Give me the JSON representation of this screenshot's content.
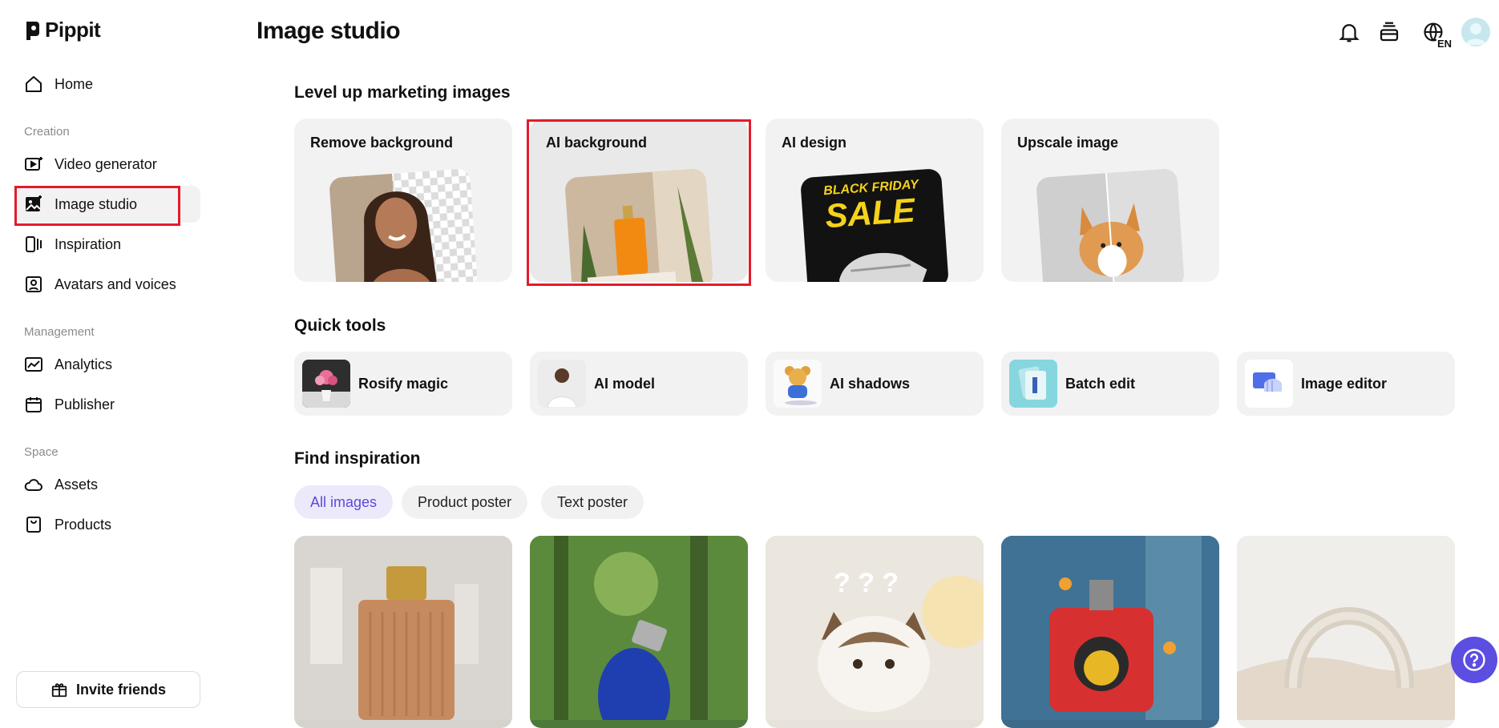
{
  "app": {
    "brand": "Pippit"
  },
  "header": {
    "title": "Image studio",
    "language": "EN"
  },
  "sidebar": {
    "home": "Home",
    "sections": {
      "creation": "Creation",
      "management": "Management",
      "space": "Space"
    },
    "items": {
      "video_generator": "Video generator",
      "image_studio": "Image studio",
      "inspiration": "Inspiration",
      "avatars_voices": "Avatars and voices",
      "analytics": "Analytics",
      "publisher": "Publisher",
      "assets": "Assets",
      "products": "Products"
    },
    "invite": "Invite friends"
  },
  "level_up": {
    "title": "Level up marketing images",
    "cards": [
      {
        "label": "Remove background"
      },
      {
        "label": "AI background"
      },
      {
        "label": "AI design",
        "art_text_1": "BLACK FRIDAY",
        "art_text_2": "SALE"
      },
      {
        "label": "Upscale image"
      }
    ]
  },
  "quick_tools": {
    "title": "Quick tools",
    "items": [
      {
        "label": "Rosify magic"
      },
      {
        "label": "AI model"
      },
      {
        "label": "AI shadows"
      },
      {
        "label": "Batch edit"
      },
      {
        "label": "Image editor"
      }
    ]
  },
  "inspiration": {
    "title": "Find inspiration",
    "filters": [
      {
        "label": "All images",
        "active": true
      },
      {
        "label": "Product poster",
        "active": false
      },
      {
        "label": "Text poster",
        "active": false
      }
    ]
  },
  "colors": {
    "accent": "#5b4ee0",
    "highlight": "#e21b2c",
    "card_bg": "#f2f2f2"
  }
}
